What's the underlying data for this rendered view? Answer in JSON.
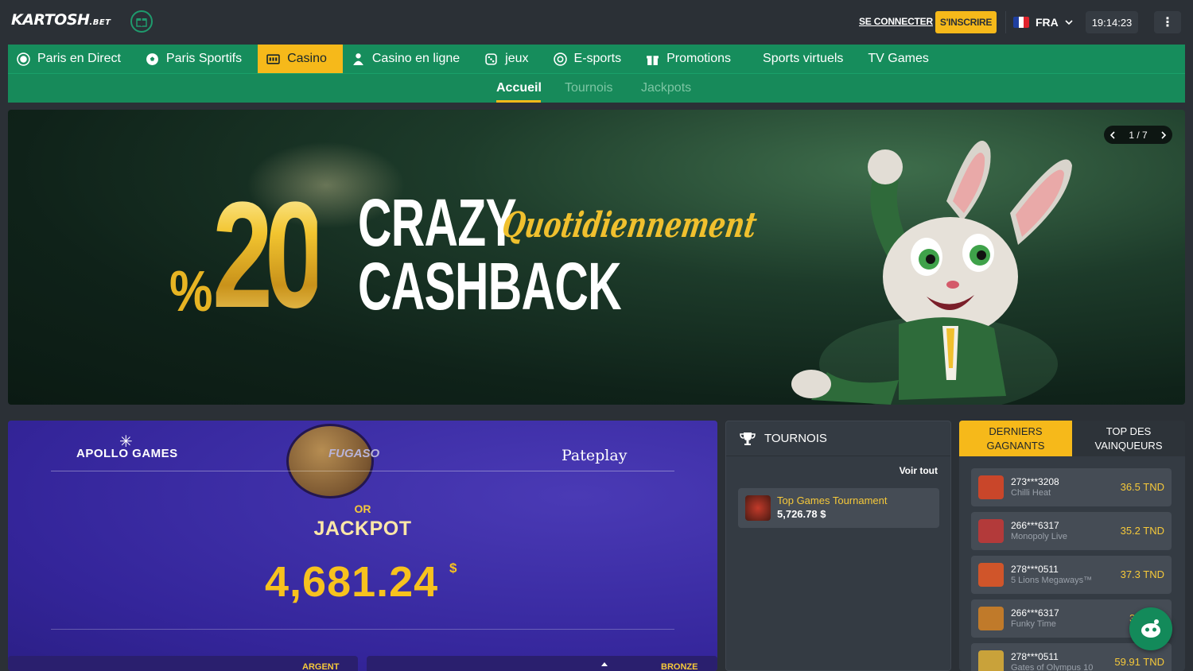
{
  "header": {
    "logo_text": "KARTOSH",
    "logo_suffix": ".BET",
    "login_label": "SE CONNECTER",
    "signup_label": "S'INSCRIRE",
    "language": "FRA",
    "time": "19:14:23",
    "menu_glyph": "⋮"
  },
  "nav": {
    "items": [
      {
        "label": "Paris en Direct",
        "icon": "live-icon"
      },
      {
        "label": "Paris Sportifs",
        "icon": "soccer-ball-icon"
      },
      {
        "label": "Casino",
        "icon": "slot-machine-icon"
      },
      {
        "label": "Casino en ligne",
        "icon": "dealer-icon"
      },
      {
        "label": "jeux",
        "icon": "dice-icon"
      },
      {
        "label": "E-sports",
        "icon": "esports-icon"
      },
      {
        "label": "Promotions",
        "icon": "gift-icon"
      },
      {
        "label": "Sports virtuels",
        "icon": ""
      },
      {
        "label": "TV Games",
        "icon": ""
      }
    ],
    "active_index": 2
  },
  "subnav": {
    "items": [
      "Accueil",
      "Tournois",
      "Jackpots"
    ],
    "active": "Accueil"
  },
  "banner": {
    "pct": "%",
    "number": "20",
    "line1": "CRAZY",
    "line2": "CASHBACK",
    "script": "Quotidiennement",
    "slide": "1 / 7"
  },
  "jackpot": {
    "providers": [
      "APOLLO GAMES",
      "FUGASO",
      "Pateplay"
    ],
    "tier_label": "OR",
    "title": "JACKPOT",
    "value": "4,681.24",
    "currency": "$",
    "tiers": [
      "ARGENT",
      "BRONZE"
    ]
  },
  "tournaments": {
    "title": "TOURNOIS",
    "see_all": "Voir tout",
    "items": [
      {
        "name": "Top Games Tournament",
        "amount": "5,726.78 $"
      }
    ]
  },
  "winners": {
    "tab_active": "DERNIERS GAGNANTS",
    "tab_inactive": "TOP DES VAINQUEURS",
    "rows": [
      {
        "user": "273***3208",
        "game": "Chilli Heat",
        "amount": "36.5 TND",
        "color": "#c9462a"
      },
      {
        "user": "266***6317",
        "game": "Monopoly Live",
        "amount": "35.2 TND",
        "color": "#b33a3a"
      },
      {
        "user": "278***0511",
        "game": "5 Lions Megaways™",
        "amount": "37.3 TND",
        "color": "#d0552a"
      },
      {
        "user": "266***6317",
        "game": "Funky Time",
        "amount": "30",
        "color": "#c07a2a"
      },
      {
        "user": "278***0511",
        "game": "Gates of Olympus 10",
        "amount": "59.91 TND",
        "color": "#c9a23a"
      }
    ]
  },
  "colors": {
    "accent": "#f6b91a",
    "nav_green": "#168d5c",
    "background": "#2b3036"
  }
}
